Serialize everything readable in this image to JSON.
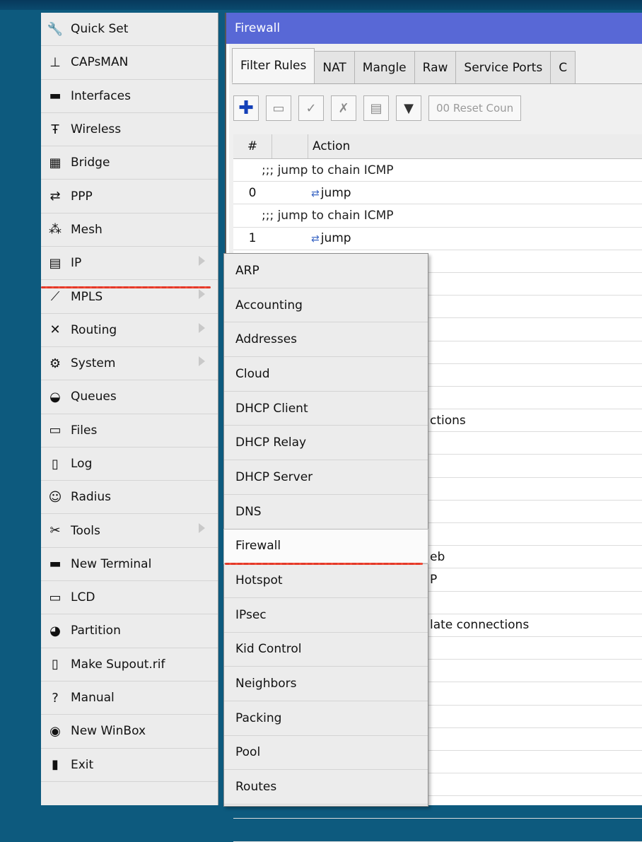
{
  "main_menu": [
    {
      "label": "Quick Set",
      "icon": "quick-set-icon",
      "glyph": "🔧",
      "submenu": false
    },
    {
      "label": "CAPsMAN",
      "icon": "antenna-icon",
      "glyph": "⊥",
      "submenu": false
    },
    {
      "label": "Interfaces",
      "icon": "interfaces-icon",
      "glyph": "▬",
      "submenu": false
    },
    {
      "label": "Wireless",
      "icon": "wireless-icon",
      "glyph": "Ŧ",
      "submenu": false
    },
    {
      "label": "Bridge",
      "icon": "bridge-icon",
      "glyph": "▦",
      "submenu": false
    },
    {
      "label": "PPP",
      "icon": "ppp-icon",
      "glyph": "⇄",
      "submenu": false
    },
    {
      "label": "Mesh",
      "icon": "mesh-icon",
      "glyph": "⁂",
      "submenu": false
    },
    {
      "label": "IP",
      "icon": "ip-icon",
      "glyph": "▤",
      "submenu": true
    },
    {
      "label": "MPLS",
      "icon": "mpls-icon",
      "glyph": "⟋",
      "submenu": true
    },
    {
      "label": "Routing",
      "icon": "routing-icon",
      "glyph": "✕",
      "submenu": true
    },
    {
      "label": "System",
      "icon": "system-gear-icon",
      "glyph": "⚙",
      "submenu": true
    },
    {
      "label": "Queues",
      "icon": "queues-icon",
      "glyph": "◒",
      "submenu": false
    },
    {
      "label": "Files",
      "icon": "folder-icon",
      "glyph": "▭",
      "submenu": false
    },
    {
      "label": "Log",
      "icon": "log-icon",
      "glyph": "▯",
      "submenu": false
    },
    {
      "label": "Radius",
      "icon": "radius-users-icon",
      "glyph": "☺",
      "submenu": false
    },
    {
      "label": "Tools",
      "icon": "tools-icon",
      "glyph": "✂",
      "submenu": true
    },
    {
      "label": "New Terminal",
      "icon": "terminal-icon",
      "glyph": "▬",
      "submenu": false
    },
    {
      "label": "LCD",
      "icon": "lcd-monitor-icon",
      "glyph": "▭",
      "submenu": false
    },
    {
      "label": "Partition",
      "icon": "partition-pie-icon",
      "glyph": "◕",
      "submenu": false
    },
    {
      "label": "Make Supout.rif",
      "icon": "supout-file-icon",
      "glyph": "▯",
      "submenu": false
    },
    {
      "label": "Manual",
      "icon": "help-icon",
      "glyph": "?",
      "submenu": false
    },
    {
      "label": "New WinBox",
      "icon": "winbox-icon",
      "glyph": "◉",
      "submenu": false
    },
    {
      "label": "Exit",
      "icon": "exit-door-icon",
      "glyph": "▮",
      "submenu": false
    }
  ],
  "firewall_window": {
    "title": "Firewall",
    "tabs": [
      "Filter Rules",
      "NAT",
      "Mangle",
      "Raw",
      "Service Ports",
      "C"
    ],
    "reset_counters_label": "00 Reset Coun",
    "columns": {
      "number": "#",
      "action": "Action"
    },
    "rows": [
      {
        "type": "comment",
        "text": ";;; jump to chain ICMP"
      },
      {
        "type": "rule",
        "num": "0",
        "action": "jump"
      },
      {
        "type": "comment",
        "text": ";;; jump to chain ICMP"
      },
      {
        "type": "rule",
        "num": "1",
        "action": "jump"
      }
    ],
    "partial_texts": {
      "r11": "ctions",
      "r17": "eb",
      "r18": "P",
      "r20": "late connections"
    }
  },
  "ip_submenu": [
    "ARP",
    "Accounting",
    "Addresses",
    "Cloud",
    "DHCP Client",
    "DHCP Relay",
    "DHCP Server",
    "DNS",
    "Firewall",
    "Hotspot",
    "IPsec",
    "Kid Control",
    "Neighbors",
    "Packing",
    "Pool",
    "Routes"
  ],
  "highlighted": {
    "main": "IP",
    "sub": "Firewall"
  },
  "colors": {
    "desktop": "#0d5a7e",
    "window_title": "#5868d6",
    "highlight_underline": "#e23a2a"
  }
}
